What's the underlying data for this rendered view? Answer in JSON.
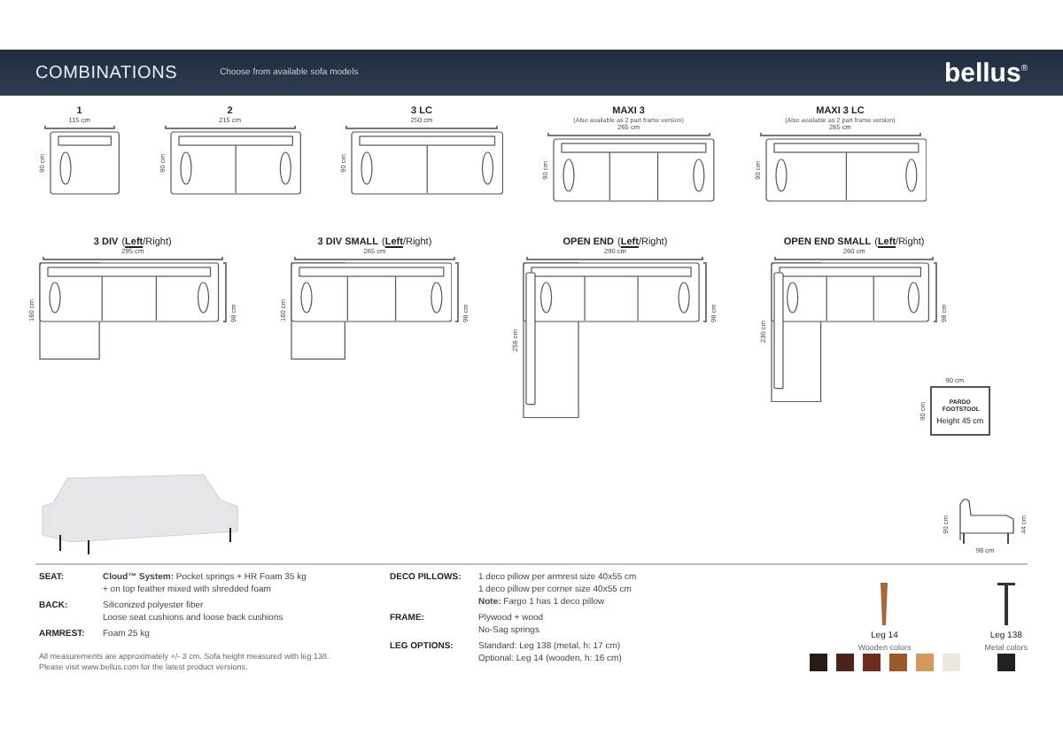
{
  "header": {
    "title": "COMBINATIONS",
    "subtitle": "Choose from available sofa models",
    "logo": "bellus",
    "logo_mark": "®"
  },
  "straight_models": [
    {
      "name": "1",
      "width": "115 cm",
      "depth": "90 cm",
      "kind": "single"
    },
    {
      "name": "2",
      "width": "215 cm",
      "depth": "90 cm",
      "kind": "double"
    },
    {
      "name": "3 LC",
      "width": "250 cm",
      "depth": "90 cm",
      "kind": "double"
    },
    {
      "name": "MAXI 3",
      "note": "(Also available as 2 part frame version)",
      "width": "265 cm",
      "depth": "90 cm",
      "kind": "triple"
    },
    {
      "name": "MAXI 3 LC",
      "note": "(Also available as 2 part frame version)",
      "width": "265 cm",
      "depth": "90 cm",
      "kind": "double"
    }
  ],
  "corner_models": [
    {
      "name": "3 DIV",
      "kind": "chaise",
      "open": "(",
      "close": ")",
      "separator": "/",
      "sides": [
        {
          "label": "Left",
          "selected": true
        },
        {
          "label": "Right",
          "selected": false
        }
      ],
      "width": "295 cm",
      "depth_left": "160 cm",
      "depth_right": "98 cm"
    },
    {
      "name": "3 DIV SMALL",
      "kind": "chaise",
      "open": "(",
      "close": ")",
      "separator": "/",
      "sides": [
        {
          "label": "Left",
          "selected": true
        },
        {
          "label": "Right",
          "selected": false
        }
      ],
      "width": "265 cm",
      "depth_left": "160 cm",
      "depth_right": "98 cm"
    },
    {
      "name": "OPEN END",
      "kind": "open_end",
      "open": "(",
      "close": ")",
      "separator": "/",
      "sides": [
        {
          "label": "Left",
          "selected": true
        },
        {
          "label": "Right",
          "selected": false
        }
      ],
      "width": "290 cm",
      "depth_left": "256 cm",
      "depth_right": "98 cm"
    },
    {
      "name": "OPEN END SMALL",
      "kind": "open_end",
      "open": "(",
      "close": ")",
      "separator": "/",
      "sides": [
        {
          "label": "Left",
          "selected": true
        },
        {
          "label": "Right",
          "selected": false
        }
      ],
      "width": "260 cm",
      "depth_left": "230 cm",
      "depth_right": "98 cm"
    }
  ],
  "footstool": {
    "name": "PARDO FOOTSTOOL",
    "height": "Height 45 cm",
    "width": "90 cm",
    "depth": "90 cm"
  },
  "side_view": {
    "height": "90 cm",
    "seat_height": "44 cm",
    "depth": "98 cm"
  },
  "specs_left": [
    {
      "label": "SEAT:",
      "lines": [
        "**Cloud™ System:** Pocket springs + HR Foam 35 kg",
        "+ on top feather mixed with shredded foam"
      ]
    },
    {
      "label": "BACK:",
      "lines": [
        "Siliconized polyester fiber",
        "Loose seat cushions and loose back cushions"
      ]
    },
    {
      "label": "ARMREST:",
      "lines": [
        "Foam 25 kg"
      ]
    }
  ],
  "footnote": [
    "All measurements are approximately +/- 3 cm. Sofa height measured with leg 138.",
    "Please visit www.bellus.com for the latest product versions."
  ],
  "specs_right": [
    {
      "label": "DECO PILLOWS:",
      "lines": [
        "1 deco pillow per armrest size 40x55 cm",
        "1 deco pillow per corner size 40x55 cm",
        "**Note:** Fargo 1 has 1 deco pillow"
      ]
    },
    {
      "label": "FRAME:",
      "lines": [
        "Plywood + wood",
        "No-Sag springs"
      ]
    },
    {
      "label": "LEG OPTIONS:",
      "lines": [
        "Standard: Leg 138 (metal, h: 17 cm)",
        "Optional: Leg 14 (wooden, h: 16 cm)"
      ]
    }
  ],
  "legs": [
    {
      "name": "Leg 14",
      "kind": "wooden",
      "colors_label": "Wooden colors",
      "swatches": [
        {
          "color": "#2a1a14"
        },
        {
          "color": "#4a2418"
        },
        {
          "color": "#6b2e1c"
        },
        {
          "color": "#9a5a2a"
        },
        {
          "color": "#d39a5a"
        },
        {
          "color": "#ece8df"
        }
      ]
    },
    {
      "name": "Leg 138",
      "kind": "metal",
      "colors_label": "Metal colors",
      "swatches": [
        {
          "color": "#222222"
        }
      ]
    }
  ]
}
